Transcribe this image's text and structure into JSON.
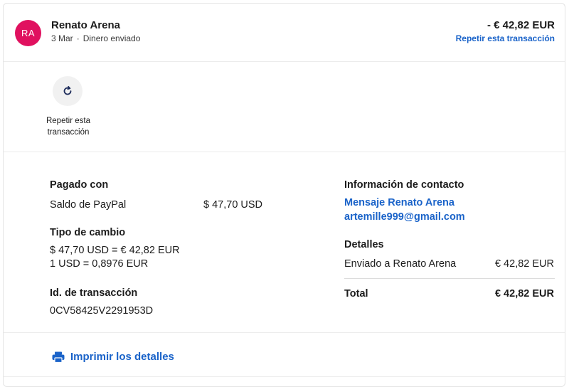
{
  "header": {
    "avatar_initials": "RA",
    "avatar_color": "#e0115f",
    "name": "Renato Arena",
    "date": "3 Mar",
    "type": "Dinero enviado",
    "amount": "- € 42,82 EUR",
    "repeat_link": "Repetir esta transacción"
  },
  "actions": {
    "repeat_label_line1": "Repetir esta",
    "repeat_label_line2": "transacción"
  },
  "details": {
    "paid_with_heading": "Pagado con",
    "paid_with_method": "Saldo de PayPal",
    "paid_with_amount": "$ 47,70 USD",
    "exchange_heading": "Tipo de cambio",
    "exchange_line1": "$ 47,70 USD = € 42,82 EUR",
    "exchange_line2": "1 USD = 0,8976 EUR",
    "transaction_id_heading": "Id. de transacción",
    "transaction_id": "0CV58425V2291953D",
    "contact_heading": "Información de contacto",
    "contact_message": "Mensaje Renato Arena",
    "contact_email": "artemille999@gmail.com",
    "details_heading": "Detalles",
    "sent_to_label": "Enviado a Renato Arena",
    "sent_to_amount": "€ 42,82 EUR",
    "total_label": "Total",
    "total_amount": "€ 42,82 EUR"
  },
  "footer": {
    "print_label": "Imprimir los detalles"
  },
  "colors": {
    "link": "#1a63c9",
    "text": "#1c1c1c"
  }
}
